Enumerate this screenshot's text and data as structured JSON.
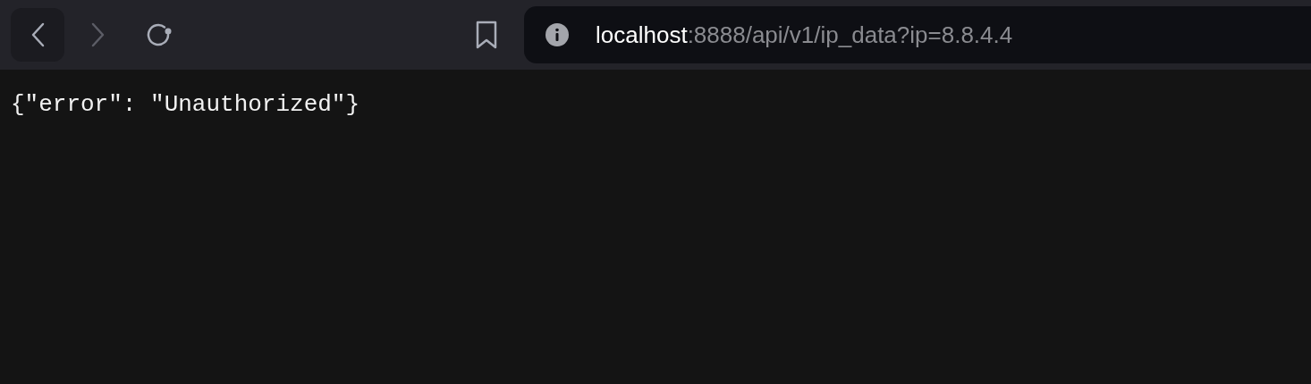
{
  "toolbar": {
    "back": {
      "disabled": false
    },
    "forward": {
      "disabled": true
    }
  },
  "address_bar": {
    "host": "localhost",
    "path": ":8888/api/v1/ip_data?ip=8.8.4.4"
  },
  "body": {
    "text": "{\"error\": \"Unauthorized\"}"
  }
}
